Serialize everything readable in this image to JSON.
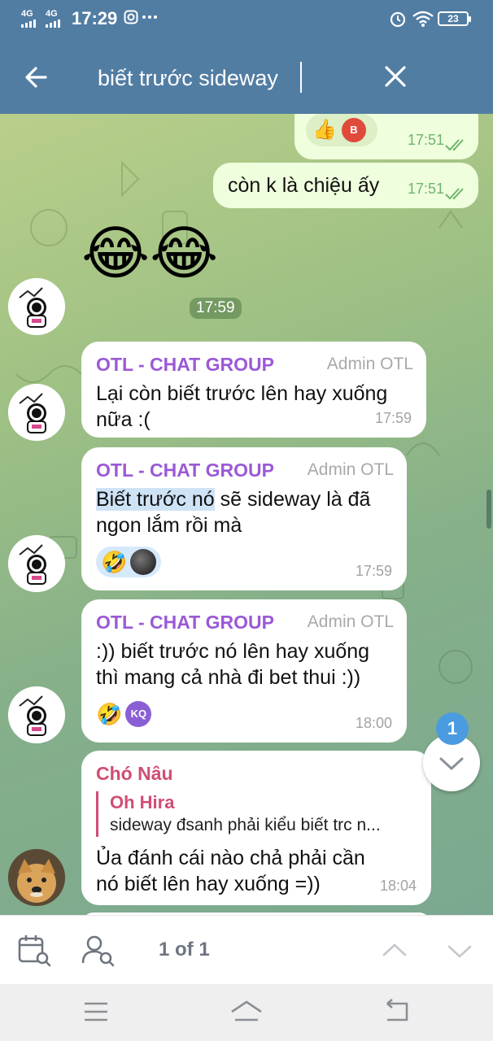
{
  "status_bar": {
    "signal_1": "4G",
    "signal_2": "4G",
    "time": "17:29",
    "battery": "23"
  },
  "header": {
    "search_value": "biết trước sideway"
  },
  "messages": {
    "out_1": {
      "reactions": [
        "👍"
      ],
      "reaction_avatar": "B",
      "time": "17:51"
    },
    "out_2": {
      "text": "còn k là chiệu ấy",
      "time": "17:51"
    },
    "sticker": {
      "emojis": "😂😂",
      "time": "17:59"
    },
    "msg_1": {
      "sender": "OTL - CHAT GROUP",
      "role": "Admin OTL",
      "text": "Lại còn biết trước lên hay xuống nữa :(",
      "time": "17:59"
    },
    "msg_2": {
      "sender": "OTL - CHAT GROUP",
      "role": "Admin OTL",
      "text_highlight": "Biết trước nó",
      "text_rest": " sẽ sideway là đã ngon lắm rồi mà",
      "reaction": "🤣",
      "time": "17:59"
    },
    "msg_3": {
      "sender": "OTL - CHAT GROUP",
      "role": "Admin OTL",
      "text": ":)) biết trước nó lên hay xuống thì mang cả nhà đi bet thui :))",
      "reaction": "🤣",
      "reaction_avatar": "KQ",
      "time": "18:00"
    },
    "msg_4": {
      "sender": "Chó Nâu",
      "reply_name": "Oh Hira",
      "reply_text": "sideway đsanh phải  kiểu  biết trc n...",
      "text": "Ủa đánh cái nào chả phải cần nó biết lên hay xuống =))",
      "time": "18:04"
    }
  },
  "scroll": {
    "unread": "1"
  },
  "bottom_bar": {
    "counter": "1 of 1"
  },
  "colors": {
    "header": "#527da3",
    "sender_purple": "#9b59d6",
    "sender_red": "#d04d72",
    "outgoing_bubble": "#effedd",
    "badge": "#4a9be0"
  }
}
